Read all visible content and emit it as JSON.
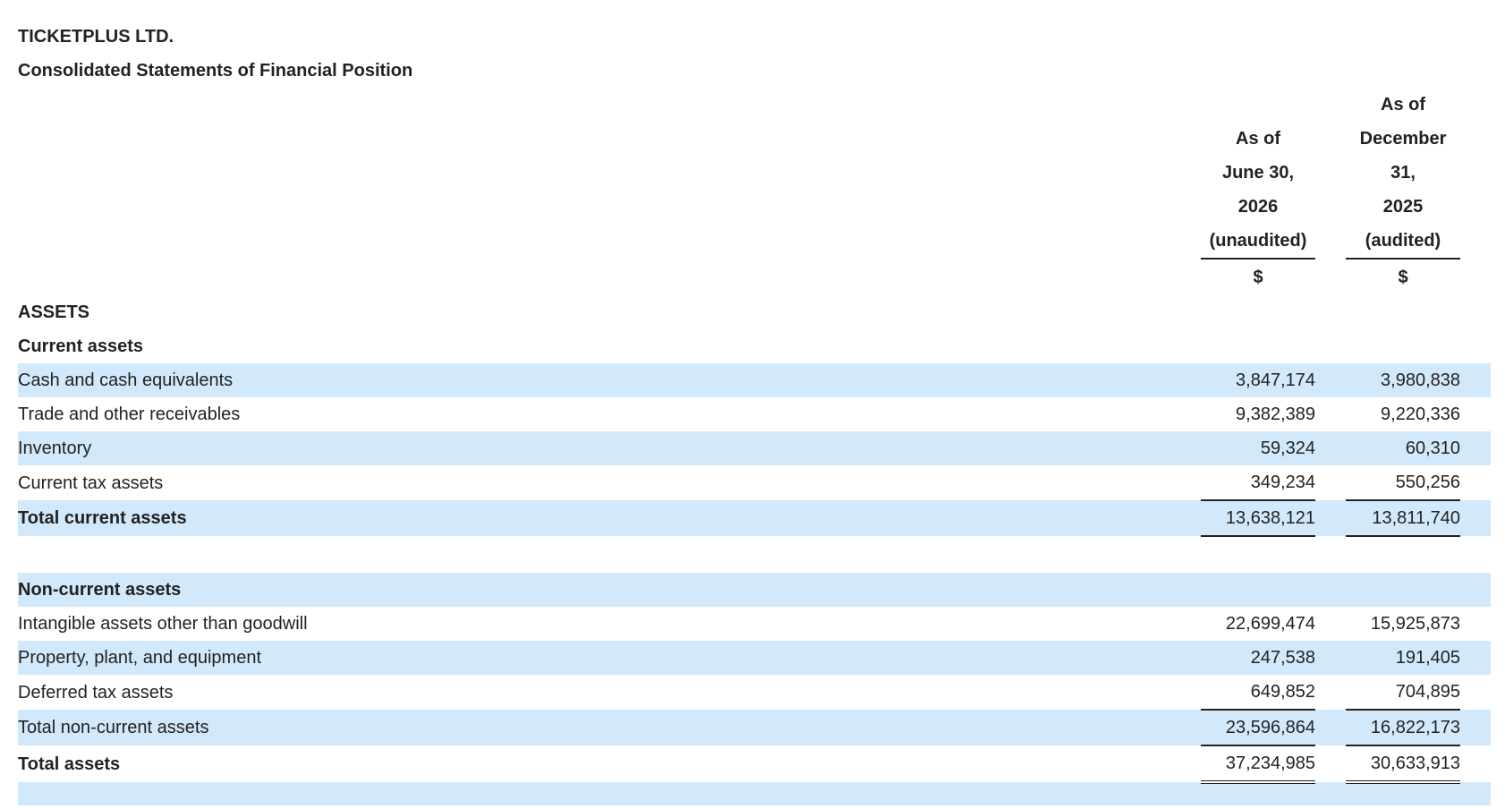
{
  "company": "TICKETPLUS LTD.",
  "statement_title": "Consolidated Statements of Financial Position",
  "columns": [
    {
      "lines": [
        "As of",
        "June 30,",
        "2026",
        "(unaudited)"
      ],
      "currency": "$"
    },
    {
      "lines": [
        "As of",
        "December",
        "31,",
        "2025",
        "(audited)"
      ],
      "currency": "$"
    }
  ],
  "sections": {
    "assets_heading": "ASSETS",
    "current_heading": "Current assets",
    "noncurrent_heading": "Non-current assets"
  },
  "current_assets": [
    {
      "label": "Cash and cash equivalents",
      "v2026": "3,847,174",
      "v2025": "3,980,838"
    },
    {
      "label": "Trade and other receivables",
      "v2026": "9,382,389",
      "v2025": "9,220,336"
    },
    {
      "label": "Inventory",
      "v2026": "59,324",
      "v2025": "60,310"
    },
    {
      "label": "Current tax assets",
      "v2026": "349,234",
      "v2025": "550,256"
    }
  ],
  "total_current_assets": {
    "label": "Total current assets",
    "v2026": "13,638,121",
    "v2025": "13,811,740"
  },
  "noncurrent_assets": [
    {
      "label": "Intangible assets other than goodwill",
      "v2026": "22,699,474",
      "v2025": "15,925,873"
    },
    {
      "label": "Property, plant, and equipment",
      "v2026": "247,538",
      "v2025": "191,405"
    },
    {
      "label": "Deferred tax assets",
      "v2026": "649,852",
      "v2025": "704,895"
    }
  ],
  "total_noncurrent_assets": {
    "label": "Total non-current assets",
    "v2026": "23,596,864",
    "v2025": "16,822,173"
  },
  "total_assets": {
    "label": "Total assets",
    "v2026": "37,234,985",
    "v2025": "30,633,913"
  }
}
